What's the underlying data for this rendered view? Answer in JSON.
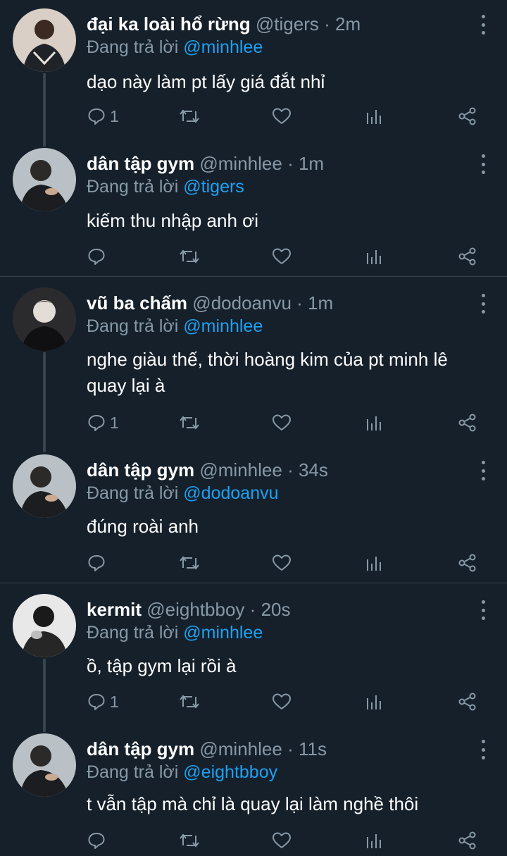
{
  "reply_prefix": "Đang trả lời",
  "tweets": [
    {
      "name": "đại ka loài hổ rừng",
      "handle": "@tigers",
      "dot": "·",
      "time": "2m",
      "reply_to": "@minhlee",
      "text": "dạo này làm pt lấy giá đắt nhỉ",
      "reply_count": "1"
    },
    {
      "name": "dân tập gym",
      "handle": "@minhlee",
      "dot": "·",
      "time": "1m",
      "reply_to": "@tigers",
      "text": "kiếm thu nhập anh ơi",
      "reply_count": ""
    },
    {
      "name": "vũ ba chấm",
      "handle": "@dodoanvu",
      "dot": "·",
      "time": "1m",
      "reply_to": "@minhlee",
      "text": "nghe giàu thế, thời hoàng kim của pt minh lê quay lại à",
      "reply_count": "1"
    },
    {
      "name": "dân tập gym",
      "handle": "@minhlee",
      "dot": "·",
      "time": "34s",
      "reply_to": "@dodoanvu",
      "text": "đúng roài anh",
      "reply_count": ""
    },
    {
      "name": "kermit",
      "handle": "@eightbboy",
      "dot": "·",
      "time": "20s",
      "reply_to": "@minhlee",
      "text": "ồ, tập gym lại rồi à",
      "reply_count": "1"
    },
    {
      "name": "dân tập gym",
      "handle": "@minhlee",
      "dot": "·",
      "time": "11s",
      "reply_to": "@eightbboy",
      "text": "t vẫn tập mà chỉ là quay lại làm nghề thôi",
      "reply_count": ""
    }
  ],
  "icons": {
    "reply": "reply-icon",
    "retweet": "retweet-icon",
    "like": "like-icon",
    "analytics": "analytics-icon",
    "share": "share-icon",
    "more": "more-vertical-icon"
  },
  "colors": {
    "background": "#15202b",
    "accent": "#1da1f2",
    "muted": "#8899a6",
    "line": "#38444d"
  }
}
